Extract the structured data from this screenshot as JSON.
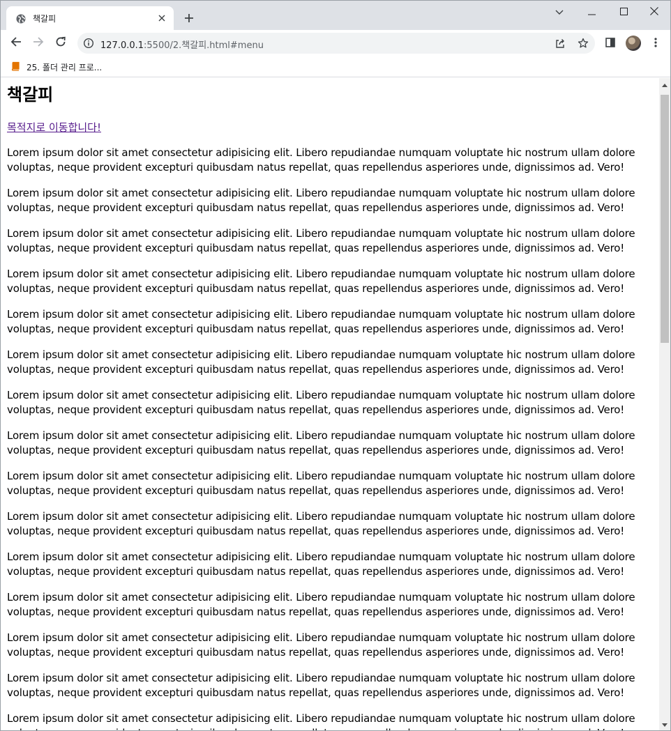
{
  "browser": {
    "tab": {
      "title": "책갈피"
    },
    "url": {
      "host": "127.0.0.1",
      "rest": ":5500/2.책갈피.html#menu"
    },
    "bookmark": {
      "label": "25. 폴더 관리 프로..."
    }
  },
  "page": {
    "heading": "책갈피",
    "link": "목적지로 이동합니다!",
    "paragraphs": [
      "Lorem ipsum dolor sit amet consectetur adipisicing elit. Libero repudiandae numquam voluptate hic nostrum ullam dolore voluptas, neque provident excepturi quibusdam natus repellat, quas repellendus asperiores unde, dignissimos ad. Vero!",
      "Lorem ipsum dolor sit amet consectetur adipisicing elit. Libero repudiandae numquam voluptate hic nostrum ullam dolore voluptas, neque provident excepturi quibusdam natus repellat, quas repellendus asperiores unde, dignissimos ad. Vero!",
      "Lorem ipsum dolor sit amet consectetur adipisicing elit. Libero repudiandae numquam voluptate hic nostrum ullam dolore voluptas, neque provident excepturi quibusdam natus repellat, quas repellendus asperiores unde, dignissimos ad. Vero!",
      "Lorem ipsum dolor sit amet consectetur adipisicing elit. Libero repudiandae numquam voluptate hic nostrum ullam dolore voluptas, neque provident excepturi quibusdam natus repellat, quas repellendus asperiores unde, dignissimos ad. Vero!",
      "Lorem ipsum dolor sit amet consectetur adipisicing elit. Libero repudiandae numquam voluptate hic nostrum ullam dolore voluptas, neque provident excepturi quibusdam natus repellat, quas repellendus asperiores unde, dignissimos ad. Vero!",
      "Lorem ipsum dolor sit amet consectetur adipisicing elit. Libero repudiandae numquam voluptate hic nostrum ullam dolore voluptas, neque provident excepturi quibusdam natus repellat, quas repellendus asperiores unde, dignissimos ad. Vero!",
      "Lorem ipsum dolor sit amet consectetur adipisicing elit. Libero repudiandae numquam voluptate hic nostrum ullam dolore voluptas, neque provident excepturi quibusdam natus repellat, quas repellendus asperiores unde, dignissimos ad. Vero!",
      "Lorem ipsum dolor sit amet consectetur adipisicing elit. Libero repudiandae numquam voluptate hic nostrum ullam dolore voluptas, neque provident excepturi quibusdam natus repellat, quas repellendus asperiores unde, dignissimos ad. Vero!",
      "Lorem ipsum dolor sit amet consectetur adipisicing elit. Libero repudiandae numquam voluptate hic nostrum ullam dolore voluptas, neque provident excepturi quibusdam natus repellat, quas repellendus asperiores unde, dignissimos ad. Vero!",
      "Lorem ipsum dolor sit amet consectetur adipisicing elit. Libero repudiandae numquam voluptate hic nostrum ullam dolore voluptas, neque provident excepturi quibusdam natus repellat, quas repellendus asperiores unde, dignissimos ad. Vero!",
      "Lorem ipsum dolor sit amet consectetur adipisicing elit. Libero repudiandae numquam voluptate hic nostrum ullam dolore voluptas, neque provident excepturi quibusdam natus repellat, quas repellendus asperiores unde, dignissimos ad. Vero!",
      "Lorem ipsum dolor sit amet consectetur adipisicing elit. Libero repudiandae numquam voluptate hic nostrum ullam dolore voluptas, neque provident excepturi quibusdam natus repellat, quas repellendus asperiores unde, dignissimos ad. Vero!",
      "Lorem ipsum dolor sit amet consectetur adipisicing elit. Libero repudiandae numquam voluptate hic nostrum ullam dolore voluptas, neque provident excepturi quibusdam natus repellat, quas repellendus asperiores unde, dignissimos ad. Vero!",
      "Lorem ipsum dolor sit amet consectetur adipisicing elit. Libero repudiandae numquam voluptate hic nostrum ullam dolore voluptas, neque provident excepturi quibusdam natus repellat, quas repellendus asperiores unde, dignissimos ad. Vero!",
      "Lorem ipsum dolor sit amet consectetur adipisicing elit. Libero repudiandae numquam voluptate hic nostrum ullam dolore voluptas, neque provident excepturi quibusdam natus repellat, quas repellendus asperiores unde, dignissimos ad. Vero!"
    ]
  },
  "colors": {
    "tabstrip": "#dee1e6",
    "visited_link": "#551a8b",
    "bookmark_icon": "#e37400"
  },
  "icons": [
    "globe-icon",
    "close-icon",
    "plus-icon",
    "chevron-down-icon",
    "minimize-icon",
    "maximize-icon",
    "back-icon",
    "forward-icon",
    "reload-icon",
    "info-icon",
    "share-icon",
    "star-icon",
    "side-panel-icon",
    "more-icon",
    "book-icon"
  ]
}
